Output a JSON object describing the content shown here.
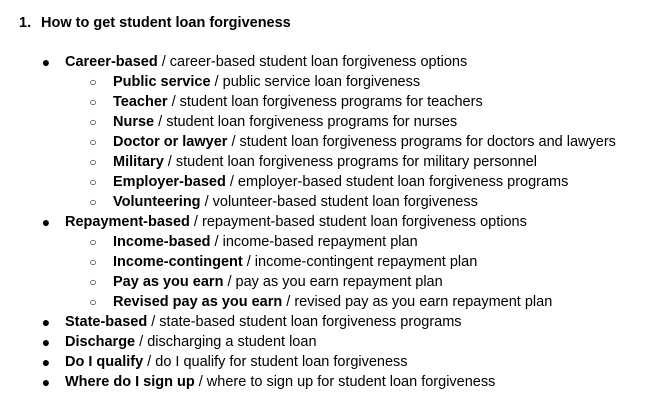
{
  "document": {
    "heading_number": "1.",
    "heading_text": "How to get student loan forgiveness",
    "items": [
      {
        "level": 1,
        "term": "Career-based",
        "description": "career-based student loan forgiveness options"
      },
      {
        "level": 2,
        "term": "Public service",
        "description": "public service loan forgiveness"
      },
      {
        "level": 2,
        "term": "Teacher",
        "description": "student loan forgiveness programs for teachers"
      },
      {
        "level": 2,
        "term": "Nurse",
        "description": "student loan forgiveness programs for nurses"
      },
      {
        "level": 2,
        "term": "Doctor or lawyer",
        "description": "student loan forgiveness programs for doctors and lawyers"
      },
      {
        "level": 2,
        "term": "Military",
        "description": "student loan forgiveness programs for military personnel"
      },
      {
        "level": 2,
        "term": "Employer-based",
        "description": "employer-based student loan forgiveness programs"
      },
      {
        "level": 2,
        "term": "Volunteering",
        "description": "volunteer-based student loan forgiveness"
      },
      {
        "level": 1,
        "term": "Repayment-based",
        "description": "repayment-based student loan forgiveness options"
      },
      {
        "level": 2,
        "term": "Income-based",
        "description": "income-based repayment plan"
      },
      {
        "level": 2,
        "term": "Income-contingent",
        "description": "income-contingent repayment plan"
      },
      {
        "level": 2,
        "term": "Pay as you earn",
        "description": "pay as you earn repayment plan"
      },
      {
        "level": 2,
        "term": "Revised pay as you earn",
        "description": "revised pay as you earn repayment plan"
      },
      {
        "level": 1,
        "term": "State-based",
        "description": "state-based student loan forgiveness programs"
      },
      {
        "level": 1,
        "term": "Discharge",
        "description": "discharging a student loan"
      },
      {
        "level": 1,
        "term": "Do I qualify",
        "description": "do I qualify for student loan forgiveness"
      },
      {
        "level": 1,
        "term": "Where do I sign up",
        "description": "where to sign up for student loan forgiveness"
      }
    ]
  },
  "bullets": {
    "level1": "●",
    "level2": "○",
    "separator": " / "
  }
}
